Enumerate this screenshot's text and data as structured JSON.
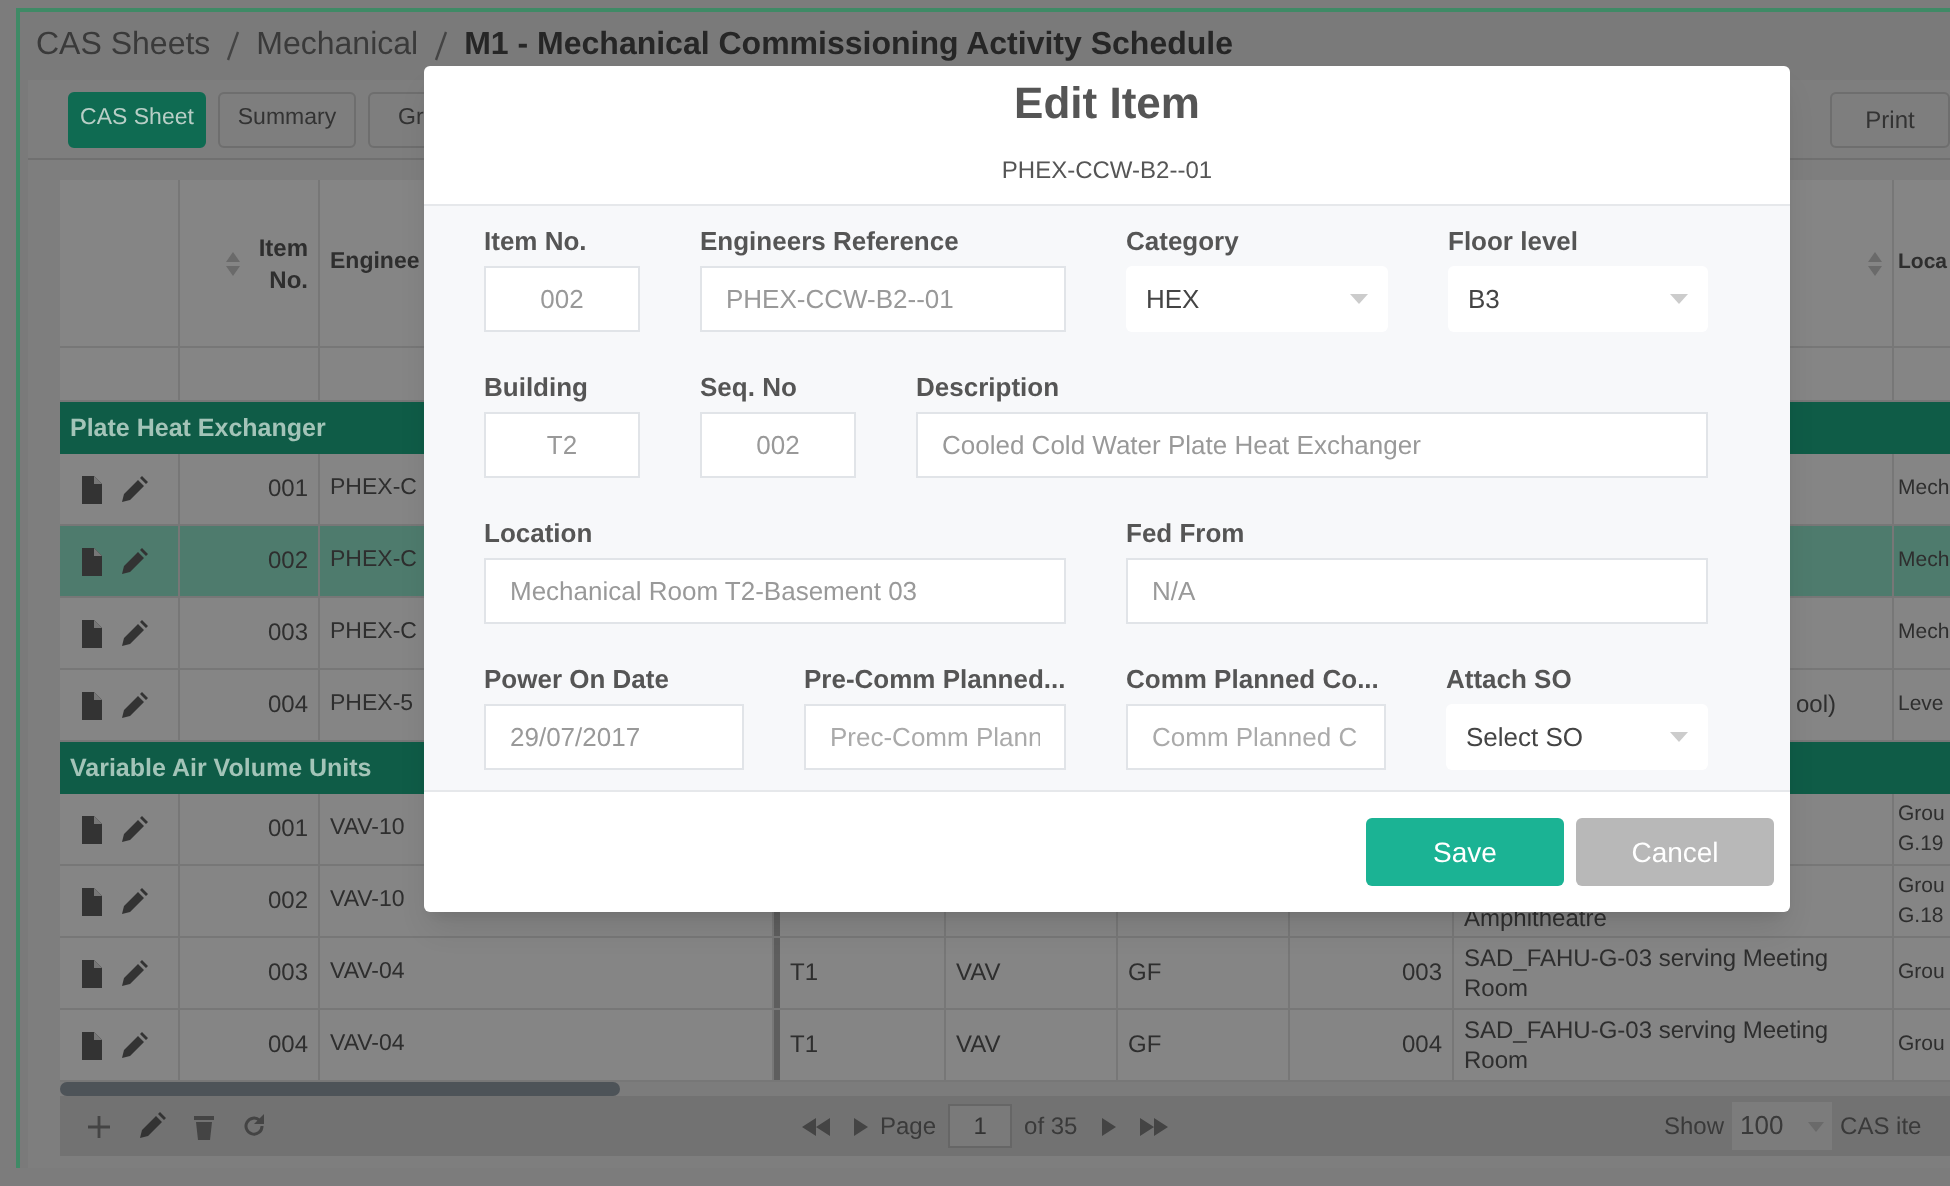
{
  "breadcrumb": [
    {
      "label": "CAS Sheets",
      "current": false
    },
    {
      "label": "Mechanical",
      "current": false
    },
    {
      "label": "M1 - Mechanical Commissioning Activity Schedule",
      "current": true
    }
  ],
  "tabs": [
    {
      "label": "CAS Sheet",
      "selected": true
    },
    {
      "label": "Summary",
      "selected": false
    },
    {
      "label": "Gr",
      "selected": false
    }
  ],
  "print_button": "Print",
  "table": {
    "columns": {
      "item_no": "Item No.",
      "engineer": "Enginee",
      "location": "Loca"
    },
    "groups": [
      {
        "title": "Plate Heat Exchanger",
        "rows": [
          {
            "item_no": "001",
            "ref": "PHEX-C",
            "location": "Mech",
            "selected": false
          },
          {
            "item_no": "002",
            "ref": "PHEX-C",
            "location": "Mech",
            "selected": true
          },
          {
            "item_no": "003",
            "ref": "PHEX-C",
            "location": "Mech",
            "selected": false
          },
          {
            "item_no": "004",
            "ref": "PHEX-5",
            "description": "ool)",
            "location": "Leve",
            "selected": false
          }
        ]
      },
      {
        "title": "Variable Air Volume Units",
        "rows": [
          {
            "item_no": "001",
            "ref": "VAV-10",
            "location": "Grou G.19",
            "selected": false
          },
          {
            "item_no": "002",
            "ref": "VAV-10",
            "description": "Amphitheatre",
            "location": "Grou G.18",
            "selected": false
          },
          {
            "item_no": "003",
            "ref": "VAV-04",
            "building": "T1",
            "category": "VAV",
            "floor": "GF",
            "seq": "003",
            "description": "SAD_FAHU-G-03 serving Meeting Room",
            "location": "Grou",
            "selected": false
          },
          {
            "item_no": "004",
            "ref": "VAV-04",
            "building": "T1",
            "category": "VAV",
            "floor": "GF",
            "seq": "004",
            "description": "SAD_FAHU-G-03 serving Meeting Room",
            "location": "Grou",
            "selected": false
          }
        ]
      }
    ]
  },
  "pager": {
    "page_label": "Page",
    "page": "1",
    "of": "of 35",
    "show_label": "Show",
    "page_size": "100",
    "items_label": "CAS ite"
  },
  "modal": {
    "title": "Edit Item",
    "subtitle": "PHEX-CCW-B2--01",
    "fields": [
      {
        "label": "Item No.",
        "kind": "short",
        "value": "002",
        "disabled": true
      },
      {
        "label": "Engineers Reference",
        "kind": "input",
        "value": "PHEX-CCW-B2--01",
        "disabled": true
      },
      {
        "label": "Category",
        "kind": "select",
        "value": "HEX"
      },
      {
        "label": "Floor level",
        "kind": "select",
        "value": "B3"
      },
      {
        "label": "Building",
        "kind": "short",
        "value": "T2",
        "disabled": true
      },
      {
        "label": "Seq. No",
        "kind": "short",
        "value": "002",
        "disabled": true
      },
      {
        "label": "Description",
        "kind": "input",
        "value": "Cooled Cold Water Plate Heat Exchanger",
        "disabled": true
      },
      {
        "label": "Location",
        "kind": "input",
        "value": "Mechanical Room T2-Basement 03",
        "disabled": true
      },
      {
        "label": "Fed From",
        "kind": "input",
        "value": "N/A",
        "disabled": true
      },
      {
        "label": "Power On Date",
        "kind": "input",
        "value": "29/07/2017",
        "disabled": true
      },
      {
        "label": "Pre-Comm Planned...",
        "kind": "input",
        "placeholder": "Prec-Comm Plann"
      },
      {
        "label": "Comm Planned Co...",
        "kind": "input",
        "placeholder": "Comm Planned C"
      },
      {
        "label": "Attach SO",
        "kind": "select",
        "value": "Select SO"
      }
    ],
    "buttons": [
      {
        "label": "Save",
        "kind": "primary"
      },
      {
        "label": "Cancel",
        "kind": "secondary"
      }
    ]
  }
}
